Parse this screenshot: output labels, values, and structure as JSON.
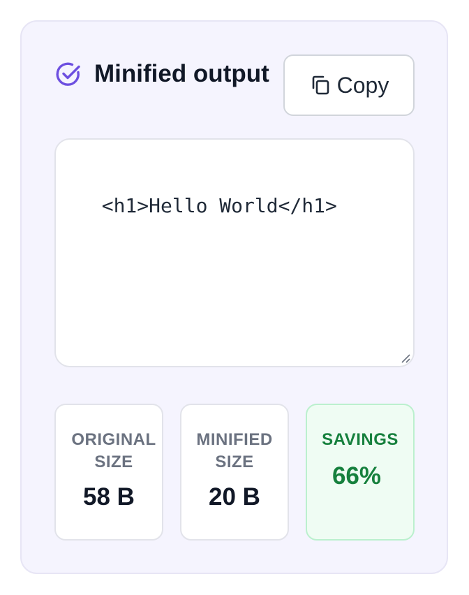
{
  "panel": {
    "title": "Minified output",
    "copy_button_label": "Copy",
    "output_text": "<h1>Hello World</h1>"
  },
  "stats": {
    "original": {
      "label": "ORIGINAL SIZE",
      "value": "58 B"
    },
    "minified": {
      "label": "MINIFIED SIZE",
      "value": "20 B"
    },
    "savings": {
      "label": "SAVINGS",
      "value": "66%"
    }
  },
  "colors": {
    "accent": "#6d4fe0",
    "savings_green": "#16803d",
    "panel_bg": "#f5f4fe"
  },
  "icons": {
    "title_icon": "check-circle-icon",
    "copy_icon": "copy-icon"
  }
}
